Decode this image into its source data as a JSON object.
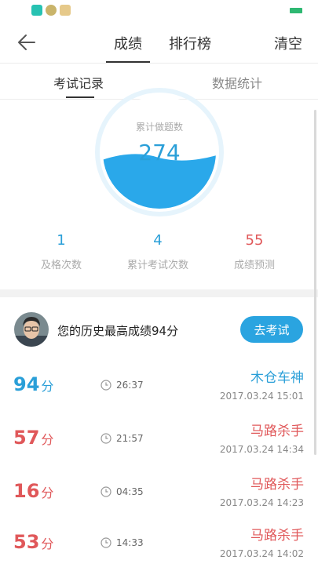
{
  "header": {
    "tabs": [
      {
        "label": "成绩"
      },
      {
        "label": "排行榜"
      }
    ],
    "clear_label": "清空"
  },
  "subtabs": [
    {
      "label": "考试记录"
    },
    {
      "label": "数据统计"
    }
  ],
  "gauge": {
    "caption": "累计做题数",
    "value": "274",
    "fill_fraction": 0.45
  },
  "stats": [
    {
      "value": "1",
      "label": "及格次数",
      "color": "#2a9fd8"
    },
    {
      "value": "4",
      "label": "累计考试次数",
      "color": "#2a9fd8"
    },
    {
      "value": "55",
      "label": "成绩预测",
      "color": "#e0585a"
    }
  ],
  "best": {
    "text": "您的历史最高成绩94分",
    "button_label": "去考试"
  },
  "records": [
    {
      "score": "94",
      "unit": "分",
      "duration": "26:37",
      "title": "木仓车神",
      "datetime": "2017.03.24 15:01",
      "color": "#2a9fd8"
    },
    {
      "score": "57",
      "unit": "分",
      "duration": "21:57",
      "title": "马路杀手",
      "datetime": "2017.03.24 14:34",
      "color": "#e0585a"
    },
    {
      "score": "16",
      "unit": "分",
      "duration": "04:35",
      "title": "马路杀手",
      "datetime": "2017.03.24 14:23",
      "color": "#e0585a"
    },
    {
      "score": "53",
      "unit": "分",
      "duration": "14:33",
      "title": "马路杀手",
      "datetime": "2017.03.24 14:02",
      "color": "#e0585a"
    }
  ],
  "colors": {
    "accent_blue": "#2a9fd8",
    "danger_red": "#e0585a",
    "button_blue": "#2aa4e0"
  }
}
